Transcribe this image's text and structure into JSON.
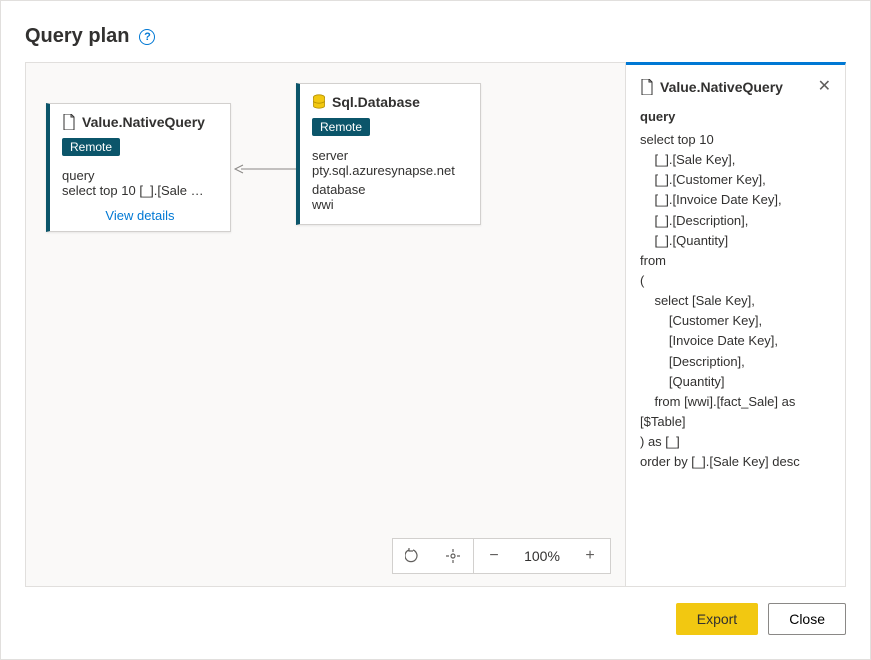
{
  "header": {
    "title": "Query plan"
  },
  "canvas": {
    "node1": {
      "title": "Value.NativeQuery",
      "badge": "Remote",
      "field_label": "query",
      "field_value": "select top 10 [_].[Sale …",
      "view_details": "View details"
    },
    "node2": {
      "title": "Sql.Database",
      "badge": "Remote",
      "server_label": "server",
      "server_value": "pty.sql.azuresynapse.net",
      "db_label": "database",
      "db_value": "wwi"
    },
    "zoom": {
      "value": "100%"
    }
  },
  "detail": {
    "title": "Value.NativeQuery",
    "field_label": "query",
    "sql": "select top 10\n    [_].[Sale Key],\n    [_].[Customer Key],\n    [_].[Invoice Date Key],\n    [_].[Description],\n    [_].[Quantity]\nfrom\n(\n    select [Sale Key],\n        [Customer Key],\n        [Invoice Date Key],\n        [Description],\n        [Quantity]\n    from [wwi].[fact_Sale] as [$Table]\n) as [_]\norder by [_].[Sale Key] desc"
  },
  "footer": {
    "export": "Export",
    "close": "Close"
  }
}
